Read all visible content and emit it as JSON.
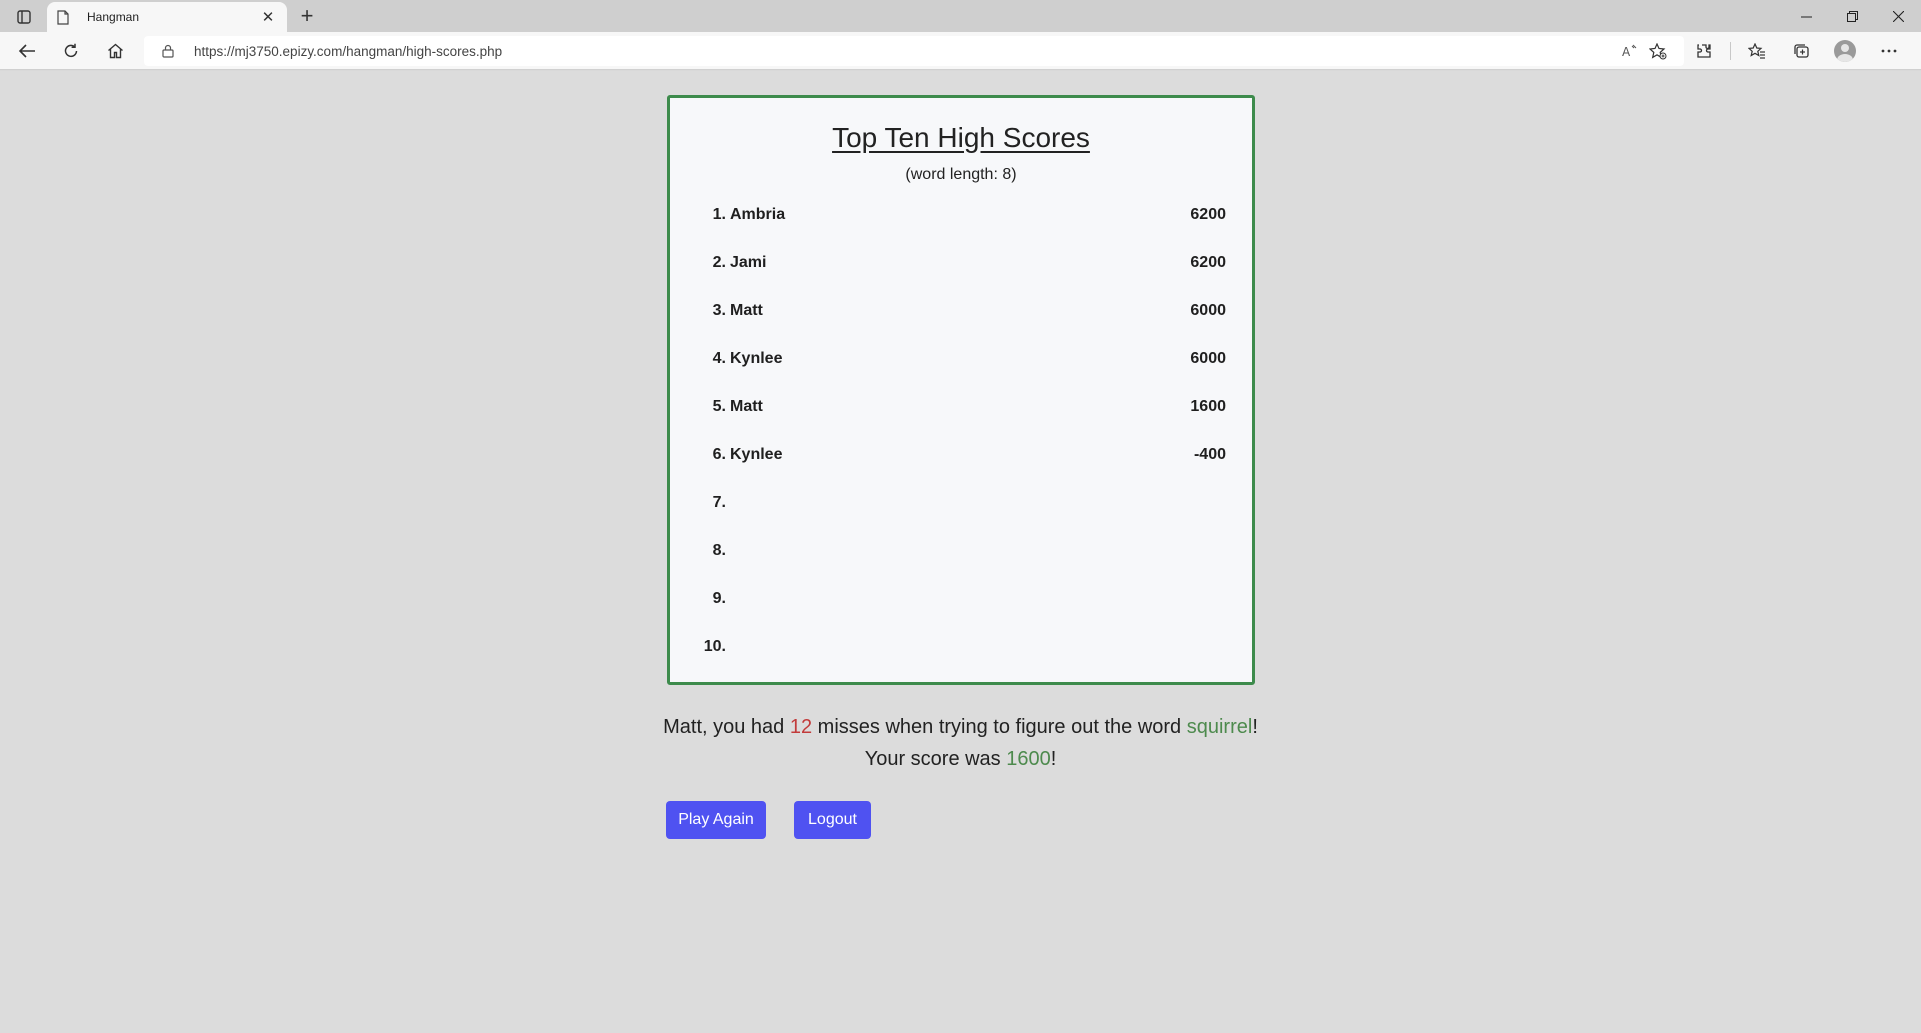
{
  "browser": {
    "tab_title": "Hangman",
    "url": "https://mj3750.epizy.com/hangman/high-scores.php",
    "new_tab_label": "+",
    "close_tab_label": "✕"
  },
  "scores": {
    "title": "Top Ten High Scores",
    "subtitle": "(word length: 8)",
    "rows": [
      {
        "rank": "1.",
        "name": "Ambria",
        "score": "6200"
      },
      {
        "rank": "2.",
        "name": "Jami",
        "score": "6200"
      },
      {
        "rank": "3.",
        "name": "Matt",
        "score": "6000"
      },
      {
        "rank": "4.",
        "name": "Kynlee",
        "score": "6000"
      },
      {
        "rank": "5.",
        "name": "Matt",
        "score": "1600"
      },
      {
        "rank": "6.",
        "name": "Kynlee",
        "score": "-400"
      },
      {
        "rank": "7.",
        "name": "",
        "score": ""
      },
      {
        "rank": "8.",
        "name": "",
        "score": ""
      },
      {
        "rank": "9.",
        "name": "",
        "score": ""
      },
      {
        "rank": "10.",
        "name": "",
        "score": ""
      }
    ]
  },
  "result": {
    "line1_prefix": "Matt, you had ",
    "misses": "12",
    "line1_middle": " misses when trying to figure out the word ",
    "word": "squirrel",
    "line1_suffix": "!",
    "line2_prefix": "Your score was ",
    "score": "1600",
    "line2_suffix": "!"
  },
  "buttons": {
    "play_again": "Play Again",
    "logout": "Logout"
  },
  "colors": {
    "card_border": "#3d8b4c",
    "button_bg": "#4f52f1",
    "misses": "#c23b3b",
    "highlight": "#4d8a4d"
  }
}
